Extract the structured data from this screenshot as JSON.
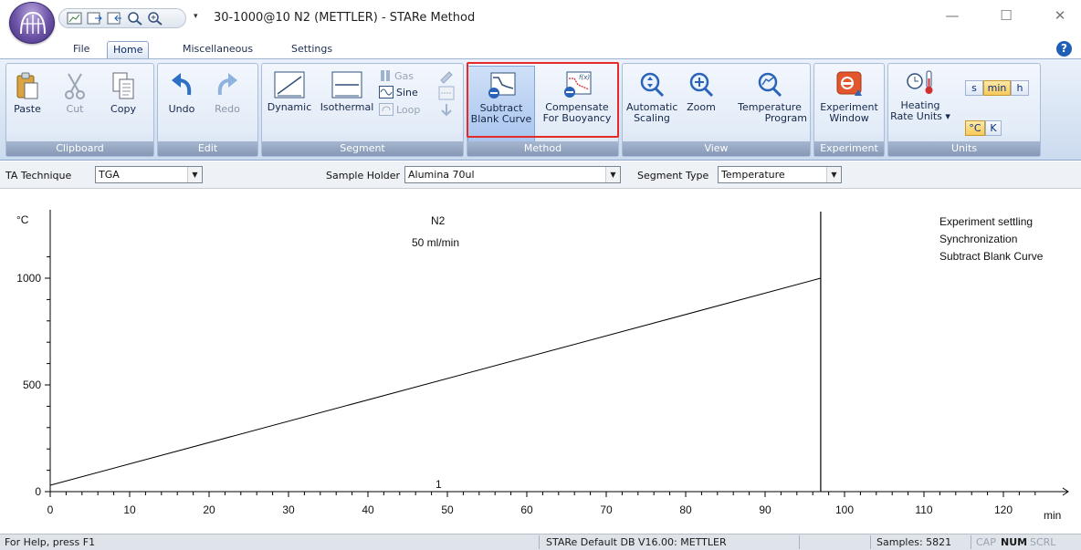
{
  "window": {
    "title": "30-1000@10 N2 (METTLER) - STARe Method",
    "qat_dropdown": "▾",
    "minimize": "—",
    "maximize": "☐",
    "close": "✕"
  },
  "tabs": [
    "File",
    "Home",
    "Miscellaneous",
    "Settings"
  ],
  "help": "?",
  "ribbon": {
    "clipboard": {
      "label": "Clipboard",
      "paste": "Paste",
      "cut": "Cut",
      "copy": "Copy"
    },
    "edit": {
      "label": "Edit",
      "undo": "Undo",
      "redo": "Redo"
    },
    "segment": {
      "label": "Segment",
      "dynamic": "Dynamic",
      "isothermal": "Isothermal",
      "gas": "Gas",
      "sine": "Sine",
      "loop": "Loop"
    },
    "method": {
      "label": "Method",
      "subtract_1": "Subtract",
      "subtract_2": "Blank Curve",
      "compensate_1": "Compensate",
      "compensate_2": "For Buoyancy"
    },
    "view": {
      "label": "View",
      "auto_1": "Automatic",
      "auto_2": "Scaling",
      "zoom": "Zoom",
      "temp_1": "Temperature",
      "temp_2": "Program"
    },
    "experiment": {
      "label": "Experiment",
      "btn_1": "Experiment",
      "btn_2": "Window"
    },
    "units": {
      "label": "Units",
      "heating_1": "Heating",
      "heating_2": "Rate Units ▾",
      "s": "s",
      "min": "min",
      "h": "h",
      "c": "°C",
      "k": "K"
    }
  },
  "params": {
    "technique_label": "TA Technique",
    "technique_value": "TGA",
    "holder_label": "Sample Holder",
    "holder_value": "Alumina 70ul",
    "segment_label": "Segment Type",
    "segment_value": "Temperature"
  },
  "plot": {
    "gas_name": "N2",
    "gas_flow": "50 ml/min",
    "status_lines": [
      "Experiment settling",
      "Synchronization",
      "Subtract Blank Curve"
    ],
    "segment_number": "1"
  },
  "chart_data": {
    "type": "line",
    "xlabel": "min",
    "ylabel": "°C",
    "xlim": [
      0,
      130
    ],
    "ylim": [
      0,
      1100
    ],
    "x_ticks": [
      0,
      10,
      20,
      30,
      40,
      50,
      60,
      70,
      80,
      90,
      100,
      110,
      120
    ],
    "y_ticks": [
      0,
      500,
      1000
    ],
    "series": [
      {
        "x": [
          0,
          97
        ],
        "y": [
          30,
          1000
        ]
      }
    ],
    "end_marker_x": 97
  },
  "status": {
    "help": "For Help, press F1",
    "db": "STARe Default DB V16.00: METTLER",
    "samples": "Samples: 5821",
    "cap": "CAP",
    "num": "NUM",
    "scrl": "SCRL"
  },
  "colors": {
    "highlight": "#e52a2a",
    "ribbon_label": "#8698b6"
  }
}
